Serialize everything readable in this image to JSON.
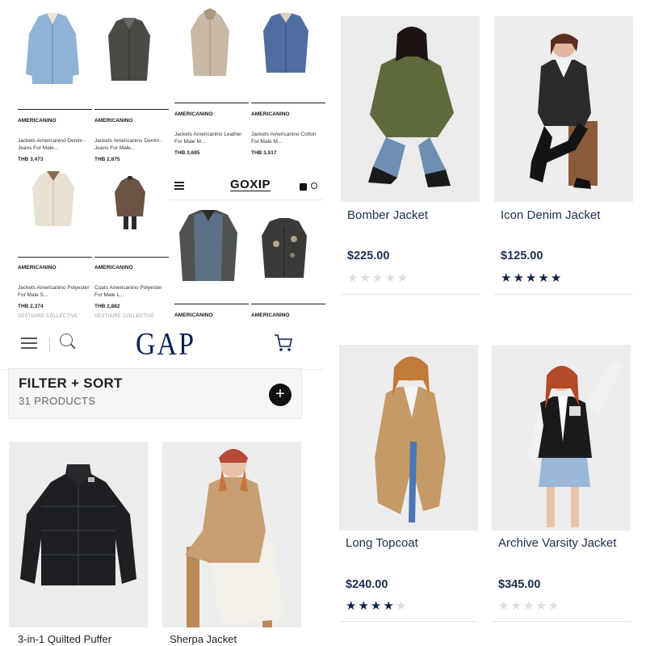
{
  "goxip_grid": {
    "top": [
      {
        "brand": "AMERICANINO",
        "title": "Jackets Americanino Denim - Jeans For Male...",
        "price": "THB 3,473"
      },
      {
        "brand": "AMERICANINO",
        "title": "Jackets Americanino Denim - Jeans For Male...",
        "price": "THB 2,875"
      },
      {
        "brand": "AMERICANINO",
        "title": "Jackets Americanino Leather For Male M...",
        "price": "THB 3,685"
      },
      {
        "brand": "AMERICANINO",
        "title": "Jackets Americanino Cotton For Male M...",
        "price": "THB 3,517"
      }
    ],
    "bottom": [
      {
        "brand": "AMERICANINO",
        "title": "Jackets Americanino Polyester For Male S...",
        "price": "THB 2,374",
        "seller": "VESTIAIRE COLLECTIVE"
      },
      {
        "brand": "AMERICANINO",
        "title": "Coats Americanino Polyester For Male L...",
        "price": "THB 2,882",
        "seller": "VESTIAIRE COLLECTIVE"
      }
    ],
    "goxip_cards": [
      {
        "brand": "AMERICANINO"
      },
      {
        "brand": "AMERICANINO"
      }
    ]
  },
  "goxip": {
    "logo": "GOXIP",
    "menu_icon": "hamburger-icon",
    "bag_icon": "bag-icon",
    "search_icon": "search-icon"
  },
  "gap_mobile": {
    "logo": "GAP",
    "filter_title": "FILTER + SORT",
    "product_count": "31 PRODUCTS",
    "add_symbol": "+",
    "card_titles": [
      "3-in-1 Quilted Puffer",
      "Sherpa Jacket"
    ]
  },
  "gap_desktop": {
    "products": [
      {
        "name": "Bomber Jacket",
        "price": "$225.00",
        "rating": 0
      },
      {
        "name": "Icon Denim Jacket",
        "price": "$125.00",
        "rating": 5
      },
      {
        "name": "Long Topcoat",
        "price": "$240.00",
        "rating": 4
      },
      {
        "name": "Archive Varsity Jacket",
        "price": "$345.00",
        "rating": 0
      }
    ],
    "star_color": "#10224d",
    "text_color": "#1b2f52"
  }
}
